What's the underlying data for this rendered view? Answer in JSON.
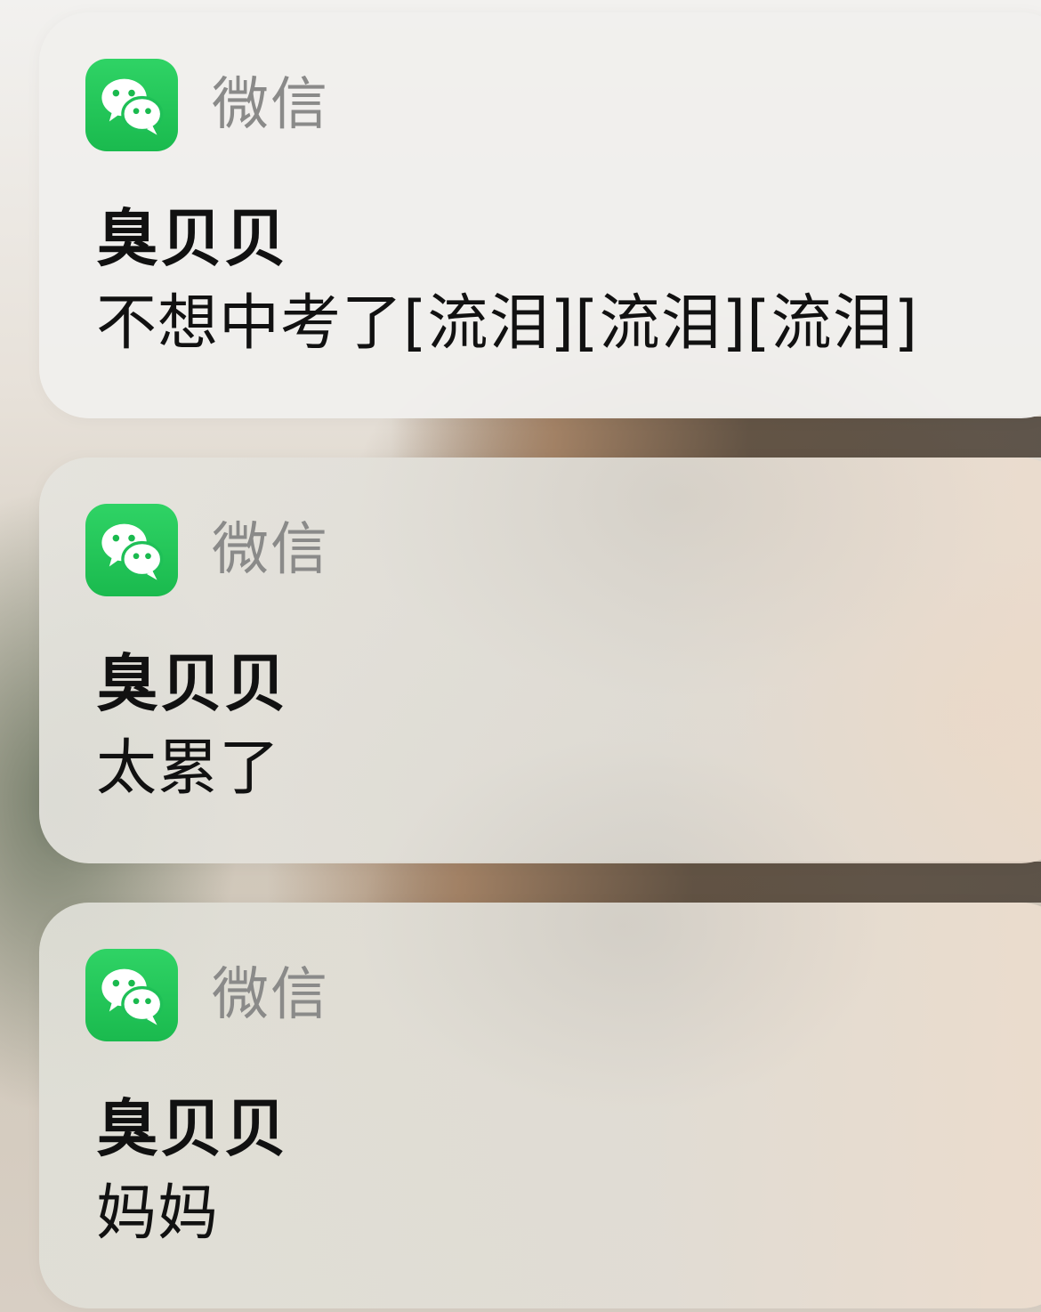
{
  "notifications": [
    {
      "app_name": "微信",
      "app_icon": "wechat-icon",
      "sender": "臭贝贝",
      "message": "不想中考了[流泪][流泪][流泪]"
    },
    {
      "app_name": "微信",
      "app_icon": "wechat-icon",
      "sender": "臭贝贝",
      "message": "太累了"
    },
    {
      "app_name": "微信",
      "app_icon": "wechat-icon",
      "sender": "臭贝贝",
      "message": "妈妈"
    }
  ],
  "colors": {
    "wechat_green": "#1aba4e",
    "app_name_gray": "#8a8a89",
    "card_background": "#eceae6"
  }
}
